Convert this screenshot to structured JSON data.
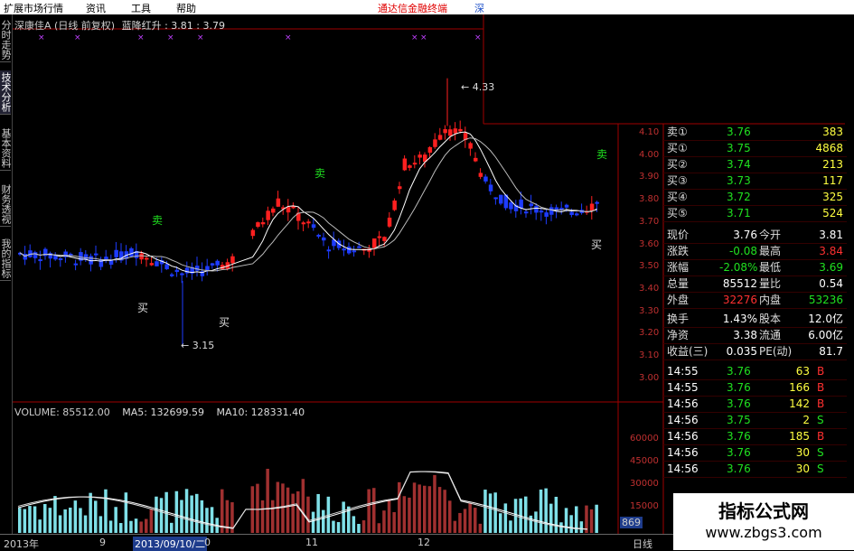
{
  "menu": {
    "items": [
      "扩展市场行情",
      "资讯",
      "工具",
      "帮助"
    ],
    "promo": "通达信金融终端",
    "symbol_tab": "深"
  },
  "left_tabs": [
    "分时走势",
    "技术分析",
    "基本资料",
    "财务透视",
    "我的指标"
  ],
  "chart_title": {
    "stock": "深康佳A (日线 前复权)",
    "indicator": "蓝降红升 : 3.81 : 3.79"
  },
  "price_axis": [
    "4.10",
    "4.00",
    "3.90",
    "3.80",
    "3.70",
    "3.60",
    "3.50",
    "3.40",
    "3.30",
    "3.20",
    "3.10",
    "3.00"
  ],
  "annotations": {
    "high": "4.33",
    "low": "3.15"
  },
  "signals": {
    "buy": "买",
    "sell": "卖"
  },
  "volume_title": {
    "vol": "VOLUME: 85512.00",
    "ma5": "MA5: 132699.59",
    "ma10": "MA10: 128331.40"
  },
  "volume_axis": [
    "60000",
    "45000",
    "30000",
    "15000"
  ],
  "volume_side_value": "869",
  "bottom_bar": {
    "year": "2013年",
    "m9": "9",
    "date": "2013/09/10/二",
    "zero": "0",
    "m11": "11",
    "m12": "12",
    "period": "日线"
  },
  "quote_panel": {
    "book": [
      {
        "label": "卖①",
        "price": "3.76",
        "vol": "383"
      },
      {
        "label": "买①",
        "price": "3.75",
        "vol": "4868"
      },
      {
        "label": "买②",
        "price": "3.74",
        "vol": "213"
      },
      {
        "label": "买③",
        "price": "3.73",
        "vol": "117"
      },
      {
        "label": "买④",
        "price": "3.72",
        "vol": "325"
      },
      {
        "label": "买⑤",
        "price": "3.71",
        "vol": "524"
      }
    ],
    "stats": [
      {
        "l1": "现价",
        "v1": "3.76",
        "l2": "今开",
        "v2": "3.81"
      },
      {
        "l1": "涨跌",
        "v1": "-0.08",
        "l2": "最高",
        "v2": "3.84"
      },
      {
        "l1": "涨幅",
        "v1": "-2.08%",
        "l2": "最低",
        "v2": "3.69"
      },
      {
        "l1": "总量",
        "v1": "85512",
        "l2": "量比",
        "v2": "0.54"
      },
      {
        "l1": "外盘",
        "v1": "32276",
        "l2": "内盘",
        "v2": "53236"
      }
    ],
    "stats2": [
      {
        "l1": "换手",
        "v1": "1.43%",
        "l2": "股本",
        "v2": "12.0亿"
      },
      {
        "l1": "净资",
        "v1": "3.38",
        "l2": "流通",
        "v2": "6.00亿"
      },
      {
        "l1": "收益(三)",
        "v1": "0.035",
        "l2": "PE(动)",
        "v2": "81.7"
      }
    ],
    "ticks": [
      {
        "t": "14:55",
        "p": "3.76",
        "v": "63",
        "s": "B"
      },
      {
        "t": "14:55",
        "p": "3.76",
        "v": "166",
        "s": "B"
      },
      {
        "t": "14:56",
        "p": "3.76",
        "v": "142",
        "s": "B"
      },
      {
        "t": "14:56",
        "p": "3.75",
        "v": "2",
        "s": "S"
      },
      {
        "t": "14:56",
        "p": "3.76",
        "v": "185",
        "s": "B"
      },
      {
        "t": "14:56",
        "p": "3.76",
        "v": "30",
        "s": "S"
      },
      {
        "t": "14:56",
        "p": "3.76",
        "v": "30",
        "s": "S"
      }
    ]
  },
  "watermark": {
    "line1": "指标公式网",
    "line2": "www.zbgs3.com"
  },
  "colors": {
    "up": "#ff2020",
    "down": "#1e3cff",
    "bg": "#000000",
    "grid": "#a00000",
    "ma": "#ffffff",
    "vol_up": "#a03030",
    "vol_down": "#7fe0e8"
  }
}
